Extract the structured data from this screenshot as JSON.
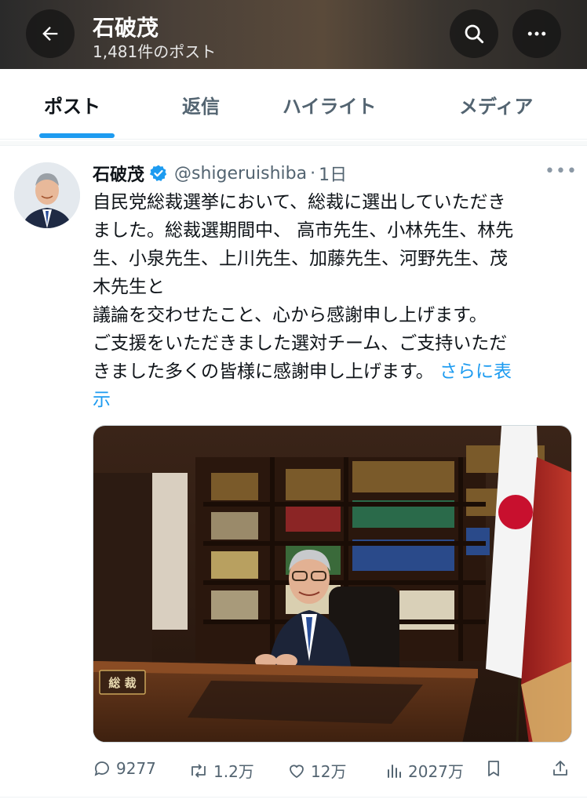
{
  "header": {
    "title": "石破茂",
    "post_count": "1,481件のポスト",
    "back_icon": "arrow-left-icon",
    "search_icon": "search-icon",
    "more_icon": "more-horizontal-icon"
  },
  "tabs": [
    {
      "label": "ポスト",
      "active": true
    },
    {
      "label": "返信",
      "active": false
    },
    {
      "label": "ハイライト",
      "active": false
    },
    {
      "label": "メディア",
      "active": false
    }
  ],
  "post": {
    "author": "石破茂",
    "handle": "@shigeruishiba",
    "separator": "·",
    "time": "1日",
    "text": "自民党総裁選挙において、総裁に選出していただき\nました。総裁選期間中、 高市先生、小林先生、林先\n生、小泉先生、上川先生、加藤先生、河野先生、茂\n木先生と\n議論を交わせたこと、心から感謝申し上げます。\nご支援をいただきました選対チーム、ご支持いただ\nきました多くの皆様に感謝申し上げます。 ",
    "show_more": "さらに表\n示",
    "image_nameplate": "総 裁",
    "actions": {
      "replies": "9277",
      "reposts": "1.2万",
      "likes": "12万",
      "views": "2027万"
    }
  },
  "colors": {
    "accent": "#1d9bf0",
    "text_primary": "#0f1419",
    "text_secondary": "#536471"
  }
}
